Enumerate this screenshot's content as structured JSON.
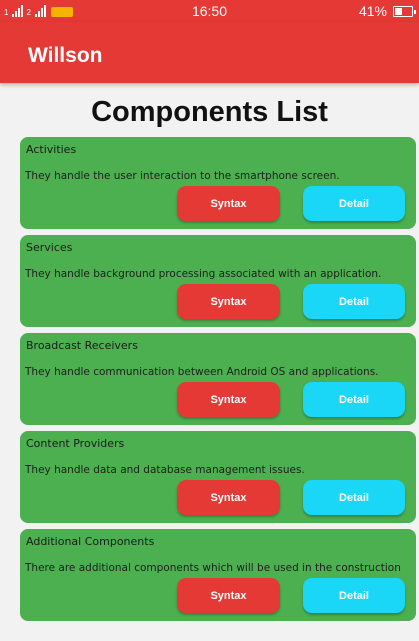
{
  "status_bar": {
    "sim1": "1",
    "sim2": "2",
    "time": "16:50",
    "battery_percent": "41%",
    "battery_level": 0.41
  },
  "app_bar": {
    "title": "Willson"
  },
  "page": {
    "title": "Components List"
  },
  "buttons": {
    "syntax": "Syntax",
    "detail": "Detail"
  },
  "cards": [
    {
      "title": "Activities",
      "description": "They handle the user interaction to the smartphone screen."
    },
    {
      "title": "Services",
      "description": "They handle background processing associated with an application."
    },
    {
      "title": "Broadcast Receivers",
      "description": "They handle communication between Android OS and applications."
    },
    {
      "title": "Content Providers",
      "description": "They handle data and database management issues."
    },
    {
      "title": "Additional Components",
      "description": "There are additional components which will be used in the construction"
    }
  ],
  "colors": {
    "primary_red": "#e53935",
    "card_green": "#4caf50",
    "detail_cyan": "#1ad7f7",
    "background": "#f2f2f2"
  }
}
